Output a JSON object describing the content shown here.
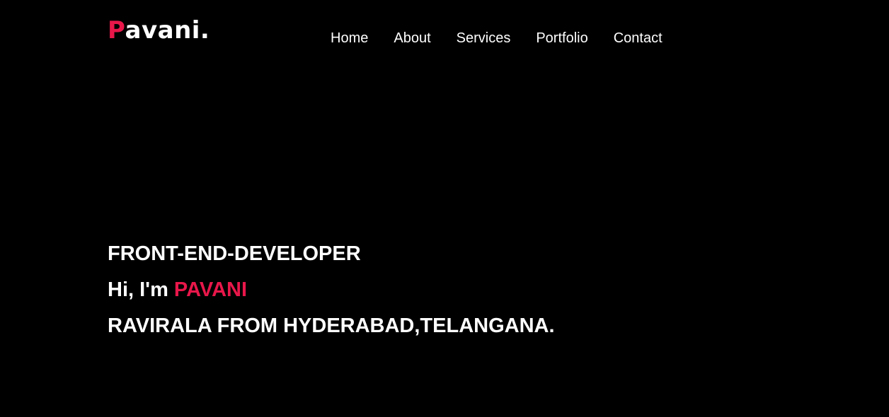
{
  "colors": {
    "background": "#000000",
    "text": "#ffffff",
    "accent": "#e8174a"
  },
  "logo": {
    "first_letter": "P",
    "rest": "avani."
  },
  "nav": {
    "items": [
      {
        "label": "Home"
      },
      {
        "label": "About"
      },
      {
        "label": "Services"
      },
      {
        "label": "Portfolio"
      },
      {
        "label": "Contact"
      }
    ]
  },
  "hero": {
    "role": "FRONT-END-DEVELOPER",
    "greeting": "Hi, I'm ",
    "name": "PAVANI",
    "tagline": "RAVIRALA FROM HYDERABAD,TELANGANA."
  }
}
